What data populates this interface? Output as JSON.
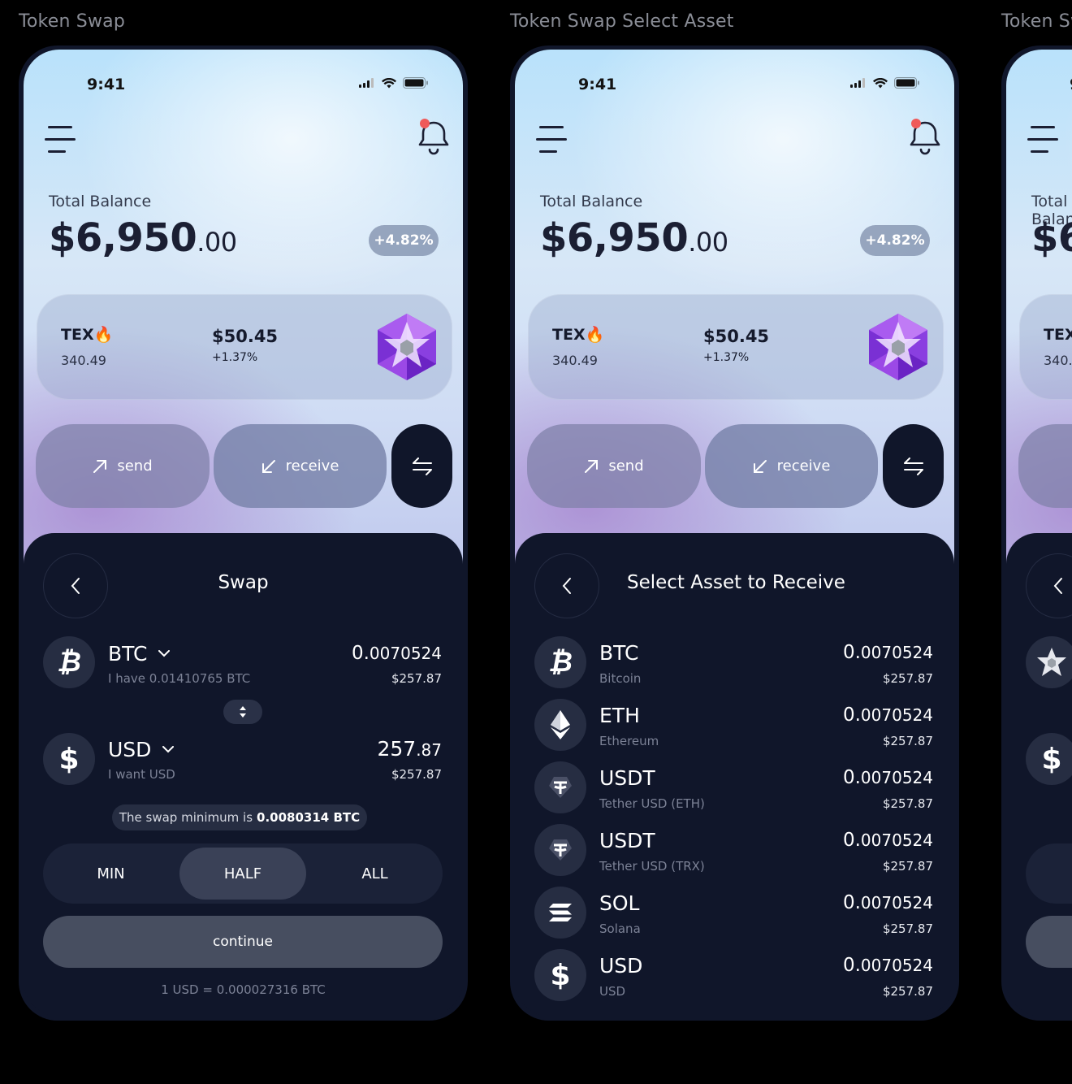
{
  "frames": [
    {
      "title": "Token Swap"
    },
    {
      "title": "Token Swap Select Asset"
    },
    {
      "title": "Token Swap"
    }
  ],
  "status": {
    "time": "9:41"
  },
  "balance": {
    "label": "Total Balance",
    "dollars": "$6,950",
    "cents": ".00",
    "change": "+4.82%"
  },
  "token": {
    "name": "TEX🔥",
    "amount": "340.49",
    "price": "$50.45",
    "change": "+1.37%"
  },
  "actions": {
    "send": "send",
    "receive": "receive"
  },
  "swap": {
    "title": "Swap",
    "from": {
      "symbol": "BTC",
      "sub": "I have 0.01410765 BTC",
      "amount_main": "0.",
      "amount_rest": "0070524",
      "usd": "$257.87"
    },
    "to": {
      "symbol": "USD",
      "sub": "I want USD",
      "amount_main": "257",
      "amount_rest": ".87",
      "usd": "$257.87"
    },
    "minimum_text": "The swap minimum is",
    "minimum_value": "0.0080314 BTC",
    "presets": [
      "MIN",
      "HALF",
      "ALL"
    ],
    "selected_preset": "HALF",
    "continue": "continue",
    "rate": "1 USD = 0.000027316 BTC"
  },
  "select": {
    "title": "Select Asset to Receive",
    "assets": [
      {
        "symbol": "BTC",
        "name": "Bitcoin",
        "amount_main": "0.",
        "amount_rest": "0070524",
        "usd": "$257.87",
        "icon": "bitcoin-icon"
      },
      {
        "symbol": "ETH",
        "name": "Ethereum",
        "amount_main": "0.",
        "amount_rest": "0070524",
        "usd": "$257.87",
        "icon": "ethereum-icon"
      },
      {
        "symbol": "USDT",
        "name": "Tether USD (ETH)",
        "amount_main": "0.",
        "amount_rest": "0070524",
        "usd": "$257.87",
        "icon": "tether-icon"
      },
      {
        "symbol": "USDT",
        "name": "Tether USD (TRX)",
        "amount_main": "0.",
        "amount_rest": "0070524",
        "usd": "$257.87",
        "icon": "tether-icon"
      },
      {
        "symbol": "SOL",
        "name": "Solana",
        "amount_main": "0.",
        "amount_rest": "0070524",
        "usd": "$257.87",
        "icon": "solana-icon"
      },
      {
        "symbol": "USD",
        "name": "USD",
        "amount_main": "0.",
        "amount_rest": "0070524",
        "usd": "$257.87",
        "icon": "dollar-icon"
      }
    ]
  },
  "colors": {
    "dark": "#10162a",
    "notification_dot": "#ef5a5a",
    "gem": "#a24dea"
  }
}
